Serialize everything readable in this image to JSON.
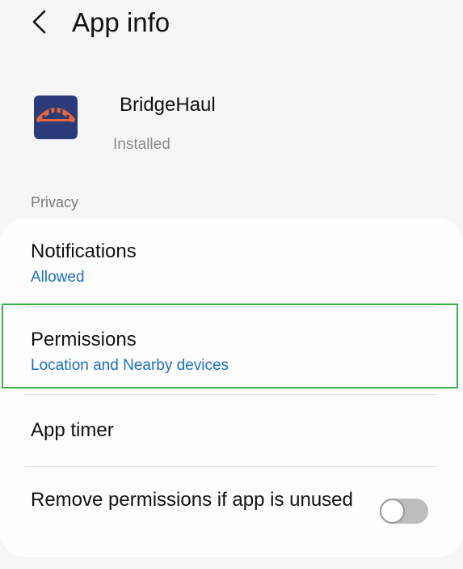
{
  "header": {
    "title": "App info",
    "back_icon": "chevron-left-icon"
  },
  "app": {
    "name": "BridgeHaul",
    "status": "Installed",
    "icon": "bridge-icon",
    "icon_colors": {
      "background": "#2b3a78",
      "arch": "#e8673a"
    }
  },
  "privacy": {
    "section_label": "Privacy",
    "items": [
      {
        "title": "Notifications",
        "subtitle": "Allowed"
      },
      {
        "title": "Permissions",
        "subtitle": "Location and Nearby devices"
      },
      {
        "title": "App timer"
      },
      {
        "title": "Remove permissions if app is unused",
        "toggle_on": false
      }
    ]
  },
  "colors": {
    "accent": "#1a6fc4",
    "highlight": "#3caf4a"
  }
}
